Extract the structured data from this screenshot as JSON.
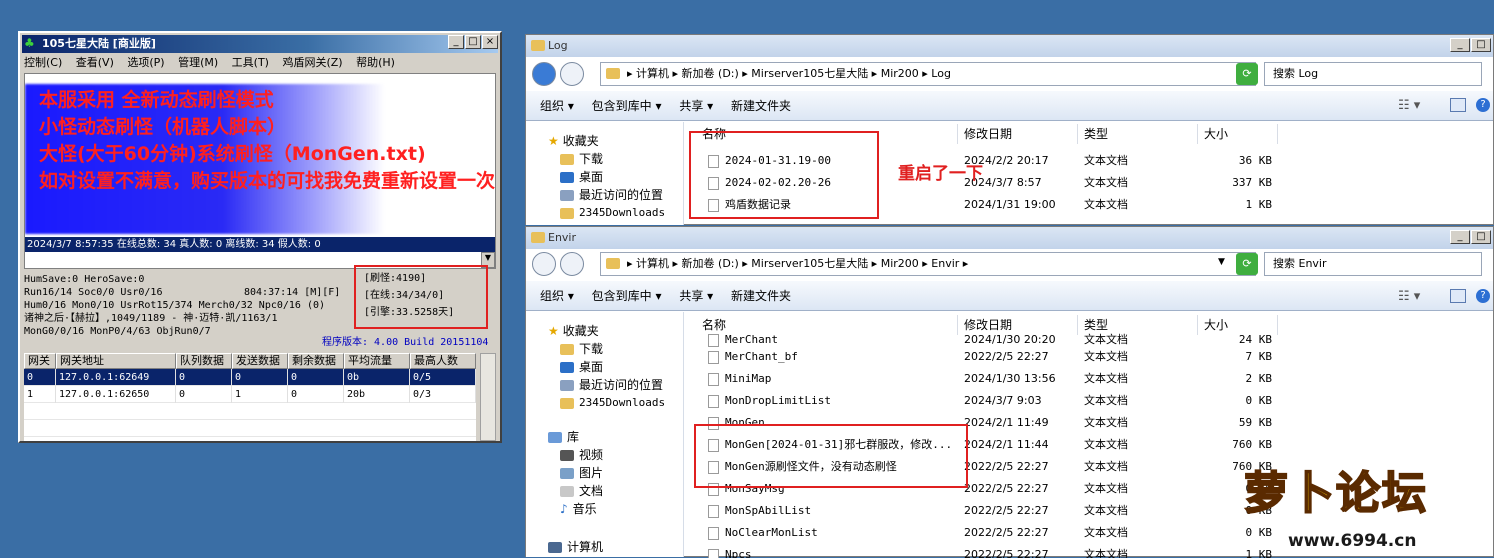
{
  "server": {
    "title": "105七星大陆 [商业版]",
    "menu": [
      "控制(C)",
      "查看(V)",
      "选项(P)",
      "管理(M)",
      "工具(T)",
      "鸡盾网关(Z)",
      "帮助(H)"
    ],
    "notice": [
      "本服采用 全新动态刷怪模式",
      "小怪动态刷怪（机器人脚本）",
      "大怪(大于60分钟)系统刷怪（MonGen.txt)",
      "如对设置不满意，购买版本的可找我免费重新设置一次"
    ],
    "logline": "2024/3/7 8:57:35 在线总数: 34 真人数: 0 离线数: 34 假人数: 0",
    "stats": [
      "HumSave:0 HeroSave:0",
      "Run16/14 Soc0/0 Usr0/16",
      "Hum0/16 Mon0/10 UsrRot15/374 Merch0/32 Npc0/16 (0)",
      "诸神之后·【赫拉】,1049/1189 - 神·迈特·凯/1163/1",
      "MonG0/0/16 MonP0/4/63 ObjRun0/7"
    ],
    "runtime": "804:37:14 [M][F]",
    "box": [
      "[刷怪:4190]",
      "[在线:34/34/0]",
      "[引擎:33.5258天]"
    ],
    "version": "程序版本: 4.00 Build 20151104",
    "gate_headers": [
      "网关",
      "网关地址",
      "队列数据",
      "发送数据",
      "剩余数据",
      "平均流量",
      "最高人数"
    ],
    "gate_rows": [
      [
        "0",
        "127.0.0.1:62649",
        "0",
        "0",
        "0",
        "0b",
        "0/5"
      ],
      [
        "1",
        "127.0.0.1:62650",
        "0",
        "1",
        "0",
        "20b",
        "0/3"
      ]
    ]
  },
  "log_window": {
    "title": "Log",
    "path": "▸ 计算机 ▸ 新加卷 (D:) ▸ Mirserver105七星大陆 ▸ Mir200 ▸ Log",
    "search": "搜索 Log",
    "toolbar": [
      "组织 ▾",
      "包含到库中 ▾",
      "共享 ▾",
      "新建文件夹"
    ],
    "nav": [
      "收藏夹",
      "下载",
      "桌面",
      "最近访问的位置",
      "2345Downloads"
    ],
    "columns": [
      "名称",
      "修改日期",
      "类型",
      "大小"
    ],
    "files": [
      [
        "2024-01-31.19-00",
        "2024/2/2 20:17",
        "文本文档",
        "36 KB"
      ],
      [
        "2024-02-02.20-26",
        "2024/3/7 8:57",
        "文本文档",
        "337 KB"
      ],
      [
        "鸡盾数据记录",
        "2024/1/31 19:00",
        "文本文档",
        "1 KB"
      ]
    ],
    "annotation": "重启了一下"
  },
  "envir_window": {
    "title": "Envir",
    "path": "▸ 计算机 ▸ 新加卷 (D:) ▸ Mirserver105七星大陆 ▸ Mir200 ▸ Envir ▸",
    "search": "搜索 Envir",
    "toolbar": [
      "组织 ▾",
      "包含到库中 ▾",
      "共享 ▾",
      "新建文件夹"
    ],
    "nav": [
      "收藏夹",
      "下载",
      "桌面",
      "最近访问的位置",
      "2345Downloads",
      "库",
      "视频",
      "图片",
      "文档",
      "音乐",
      "计算机"
    ],
    "columns": [
      "名称",
      "修改日期",
      "类型",
      "大小"
    ],
    "files": [
      [
        "MerChant",
        "2024/1/30 20:20",
        "文本文档",
        "24 KB"
      ],
      [
        "MerChant_bf",
        "2022/2/5 22:27",
        "文本文档",
        "7 KB"
      ],
      [
        "MiniMap",
        "2024/1/30 13:56",
        "文本文档",
        "2 KB"
      ],
      [
        "MonDropLimitList",
        "2024/3/7 9:03",
        "文本文档",
        "0 KB"
      ],
      [
        "MonGen",
        "2024/2/1 11:49",
        "文本文档",
        "59 KB"
      ],
      [
        "MonGen[2024-01-31]邪七群服改，修改...",
        "2024/2/1 11:44",
        "文本文档",
        "760 KB"
      ],
      [
        "MonGen源刷怪文件，没有动态刷怪",
        "2022/2/5 22:27",
        "文本文档",
        "760 KB"
      ],
      [
        "MonSayMsg",
        "2022/2/5 22:27",
        "文本文档",
        "0 KB"
      ],
      [
        "MonSpAbilList",
        "2022/2/5 22:27",
        "文本文档",
        "0 KB"
      ],
      [
        "NoClearMonList",
        "2022/2/5 22:27",
        "文本文档",
        "0 KB"
      ],
      [
        "Npcs",
        "2022/2/5 22:27",
        "文本文档",
        "1 KB"
      ]
    ]
  },
  "watermark": {
    "logo": "萝卜论坛",
    "url": "www.6994.cn"
  }
}
